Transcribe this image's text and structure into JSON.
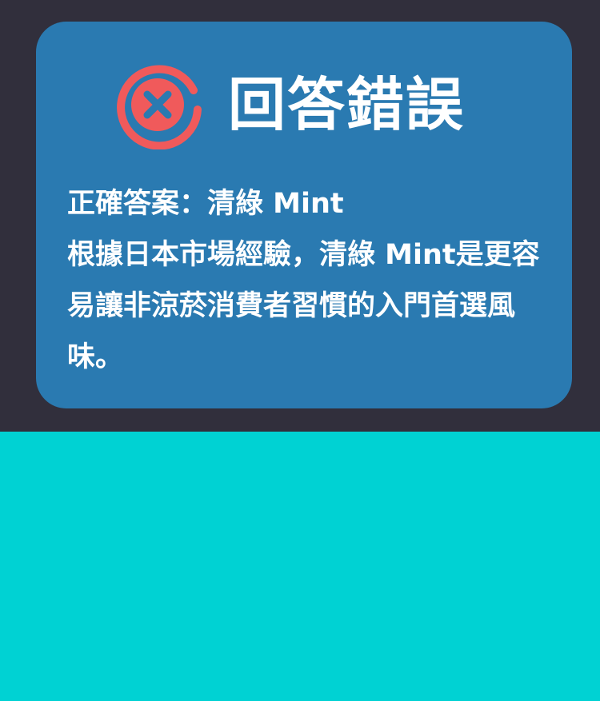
{
  "colors": {
    "top_background": "#312f3c",
    "bottom_background": "#00d2d3",
    "card": "#2a7ab1",
    "wrong_icon": "#f05a5b",
    "text": "#ffffff"
  },
  "result": {
    "icon": "x-circle-icon",
    "title": "回答錯誤",
    "answer_line": "正確答案：清綠 Mint",
    "explanation": "根據日本市場經驗，清綠 Mint是更容易讓非涼菸消費者習慣的入門首選風味。"
  }
}
